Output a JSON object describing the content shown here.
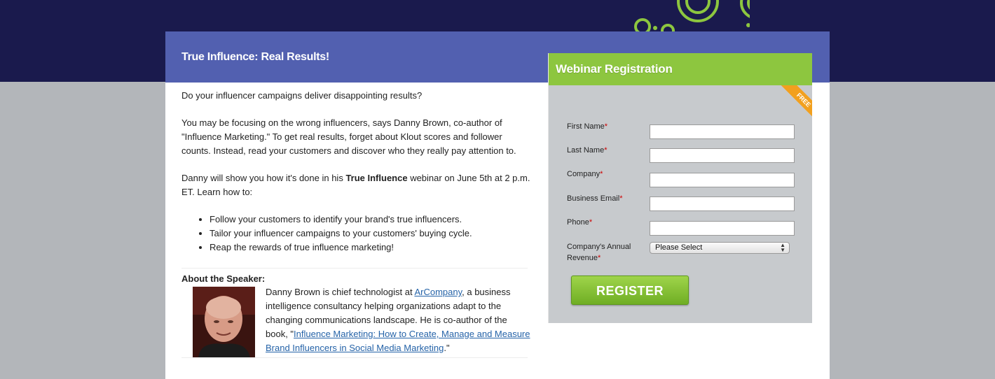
{
  "banner": {
    "title": "True Influence: Real Results!"
  },
  "content": {
    "intro": "Do your influencer campaigns deliver disappointing results?",
    "para2": "You may be focusing on the wrong influencers, says Danny Brown, co-author of \"Influence Marketing.\" To get real results, forget about Klout scores and follower counts. Instead, read your customers and discover who they really pay attention to.",
    "para3_pre": "Danny will show you how it's done in his ",
    "para3_bold": "True Influence",
    "para3_post": " webinar on June 5th at 2 p.m. ET. Learn how to:",
    "bullets": [
      "Follow your customers to identify your brand's true influencers.",
      "Tailor your influencer campaigns to your customers' buying cycle.",
      "Reap the rewards of true influence marketing!"
    ],
    "about_label": "About the Speaker:",
    "bio_pre": "Danny Brown is chief technologist at ",
    "bio_link1": "ArCompany",
    "bio_mid": ", a business intelligence consultancy helping organizations adapt to the changing communications landscape. He is co-author of the book, \"",
    "bio_link2": "Influence Marketing: How to Create, Manage and Measure Brand Influencers in Social Media Marketing",
    "bio_post": ".\""
  },
  "form": {
    "title": "Webinar Registration",
    "ribbon": "FREE",
    "fields": [
      {
        "label": "First Name",
        "required": "*",
        "value": ""
      },
      {
        "label": "Last Name",
        "required": "*",
        "value": ""
      },
      {
        "label": "Company",
        "required": "*",
        "value": ""
      },
      {
        "label": "Business Email",
        "required": "*",
        "value": ""
      },
      {
        "label": "Phone",
        "required": "*",
        "value": ""
      }
    ],
    "revenue_label_1": "Company's Annual",
    "revenue_label_2": "Revenue",
    "revenue_required": "*",
    "revenue_selected": "Please Select",
    "register_label": "REGISTER"
  },
  "colors": {
    "navy": "#1a1a4d",
    "banner": "#5260b0",
    "green": "#8dc63f",
    "ribbon": "#f2a01e",
    "link": "#2563a8"
  }
}
